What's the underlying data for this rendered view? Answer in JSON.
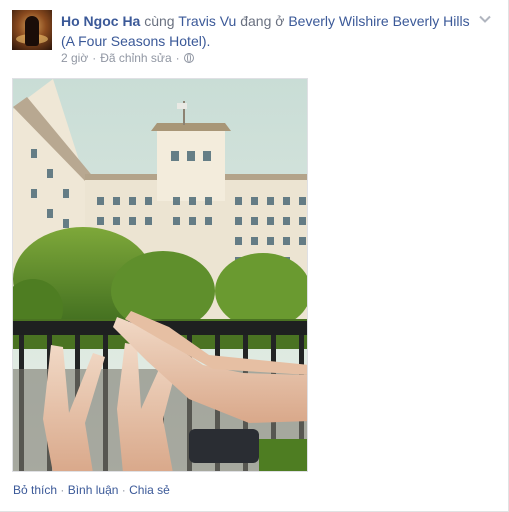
{
  "post": {
    "author": "Ho Ngoc Ha",
    "with_text": " cùng ",
    "tagged": "Travis Vu",
    "at_text": " đang ở ",
    "location": "Beverly Wilshire Beverly Hills (A Four Seasons Hotel).",
    "time": "2 giờ",
    "edited": "Đã chỉnh sửa",
    "separator": "·",
    "privacy_icon": "globe-icon",
    "options_icon": "chevron-down-icon"
  },
  "actions": {
    "like": "Bỏ thích",
    "comment": "Bình luận",
    "share": "Chia sẻ",
    "separator": "·"
  },
  "colors": {
    "link": "#3b5998",
    "text": "#141823",
    "meta": "#9197a3"
  }
}
